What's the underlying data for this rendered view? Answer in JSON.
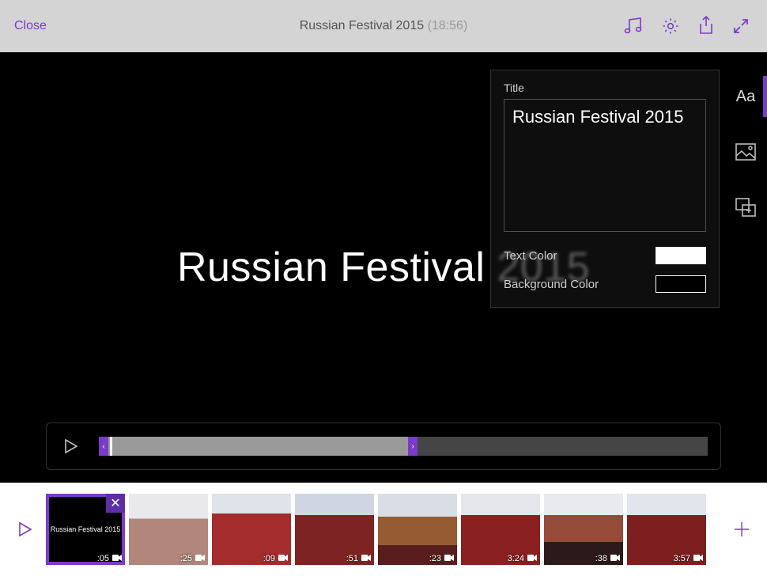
{
  "topbar": {
    "close_label": "Close",
    "project_title": "Russian Festival 2015",
    "project_duration": "(18:56)"
  },
  "preview": {
    "title_text": "Russian Festival 2015"
  },
  "inspector": {
    "title_label": "Title",
    "title_value": "Russian Festival 2015",
    "text_color_label": "Text Color",
    "text_color_value": "#ffffff",
    "background_color_label": "Background Color",
    "background_color_value": "#000000"
  },
  "toolstrip": {
    "items": [
      {
        "name": "text-tool",
        "glyph": "Aa",
        "active": true
      },
      {
        "name": "media-tool",
        "active": false
      },
      {
        "name": "overlay-tool",
        "active": false
      }
    ]
  },
  "timeline": {
    "clips": [
      {
        "duration": ":05",
        "type": "title",
        "label": "Russian Festival 2015",
        "selected": true
      },
      {
        "duration": ":25",
        "type": "video"
      },
      {
        "duration": ":09",
        "type": "video"
      },
      {
        "duration": ":51",
        "type": "video"
      },
      {
        "duration": ":23",
        "type": "video"
      },
      {
        "duration": "3:24",
        "type": "video"
      },
      {
        "duration": ":38",
        "type": "video"
      },
      {
        "duration": "3:57",
        "type": "video"
      }
    ]
  },
  "colors": {
    "accent": "#7b3bca"
  }
}
